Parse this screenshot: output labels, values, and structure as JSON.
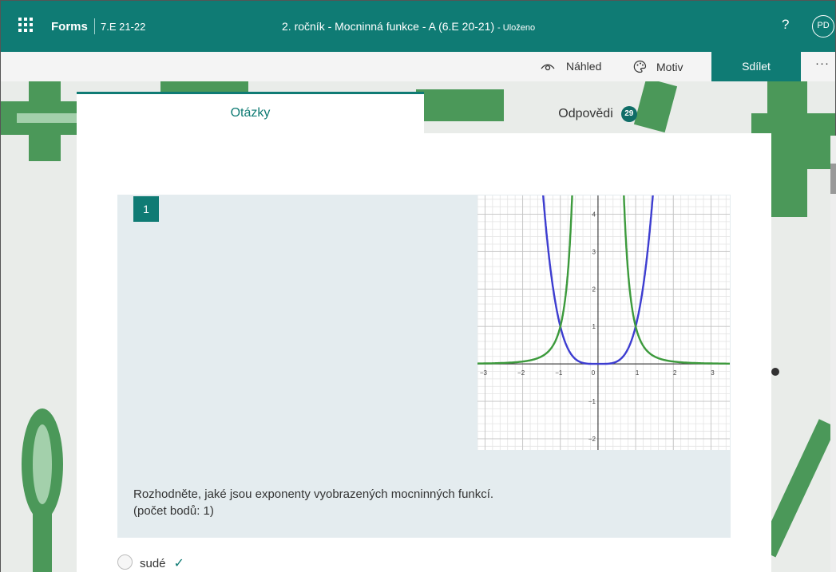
{
  "app": {
    "name": "Forms",
    "course": "7.E 21-22"
  },
  "document": {
    "title": "2. ročník - Mocninná funkce - A  (6.E 20-21)",
    "saved": "- Uloženo"
  },
  "header": {
    "help": "?",
    "avatar": "PD"
  },
  "toolbar": {
    "preview": "Náhled",
    "theme": "Motiv",
    "share": "Sdílet",
    "more": "···"
  },
  "tabs": {
    "questions": "Otázky",
    "responses": "Odpovědi",
    "responses_count": "29"
  },
  "question": {
    "number": "1",
    "text": "Rozhodněte, jaké jsou exponenty vyobrazených mocninných funkcí.",
    "points": "(počet bodů: 1)",
    "options": [
      {
        "label": "sudé",
        "correct": true
      }
    ]
  },
  "chart_data": {
    "type": "line",
    "xlim": [
      -3.2,
      3.5
    ],
    "ylim": [
      -2.3,
      4.5
    ],
    "x_ticks": [
      -3,
      -2,
      -1,
      0,
      1,
      2,
      3
    ],
    "y_ticks": [
      -2,
      -1,
      1,
      2,
      3,
      4
    ],
    "series": [
      {
        "function": "x^4",
        "color": "#3d3dd0"
      },
      {
        "function": "x^-4",
        "color": "#3c9a3c"
      }
    ],
    "grid": true
  },
  "colors": {
    "accent": "#0f7b74"
  }
}
